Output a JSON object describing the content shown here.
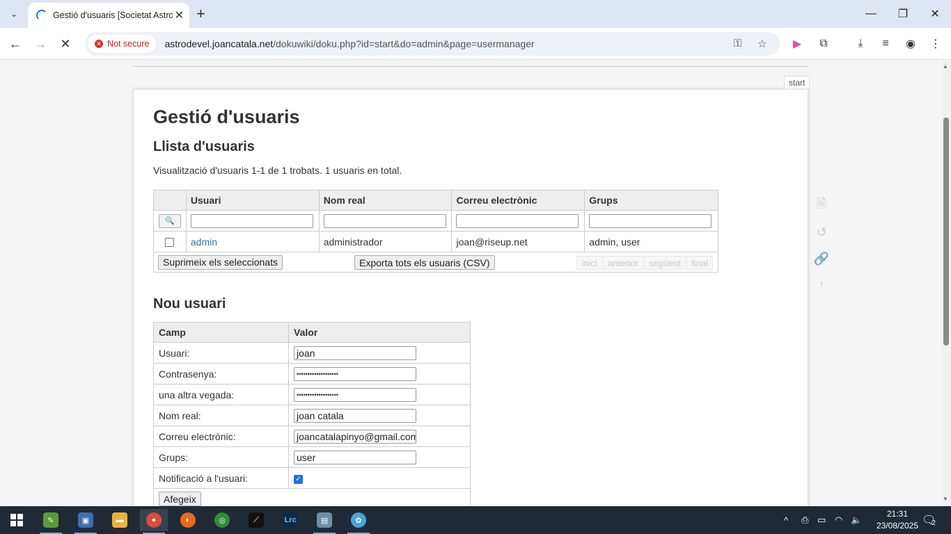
{
  "browser": {
    "tab_title": "Gestió d'usuaris [Societat Astro",
    "security_label": "Not secure",
    "url_host": "astrodevel.joancatala.net",
    "url_path": "/dokuwiki/doku.php?id=start&do=admin&page=usermanager"
  },
  "page": {
    "start_badge": "start",
    "title": "Gestió d'usuaris",
    "list_heading": "Llista d'usuaris",
    "summary": "Visualització d'usuaris 1-1 de 1 trobats. 1 usuaris en total.",
    "columns": [
      "Usuari",
      "Nom real",
      "Correu electrònic",
      "Grups"
    ],
    "users": [
      {
        "login": "admin",
        "name": "administrador",
        "email": "joan@riseup.net",
        "groups": "admin, user"
      }
    ],
    "delete_button": "Suprimeix els seleccionats",
    "export_button": "Exporta tots els usuaris (CSV)",
    "pager": [
      "inici",
      "anterior",
      "següent",
      "final"
    ],
    "new_heading": "Nou usuari",
    "new_columns": [
      "Camp",
      "Valor"
    ],
    "fields": {
      "user_label": "Usuari:",
      "user_value": "joan",
      "pass_label": "Contrasenya:",
      "pass_value": "•••••••••••••••••••",
      "pass2_label": "una altra vegada:",
      "pass2_value": "•••••••••••••••••••",
      "name_label": "Nom real:",
      "name_value": "joan catala",
      "email_label": "Correu electrònic:",
      "email_value": "joancatalapinyo@gmail.com",
      "groups_label": "Grups:",
      "groups_value": "user",
      "notify_label": "Notificació a l'usuari:",
      "notify_checked": true
    },
    "add_button": "Afegeix"
  },
  "taskbar": {
    "time": "21:31",
    "date": "23/08/2025",
    "notification_count": "2"
  }
}
